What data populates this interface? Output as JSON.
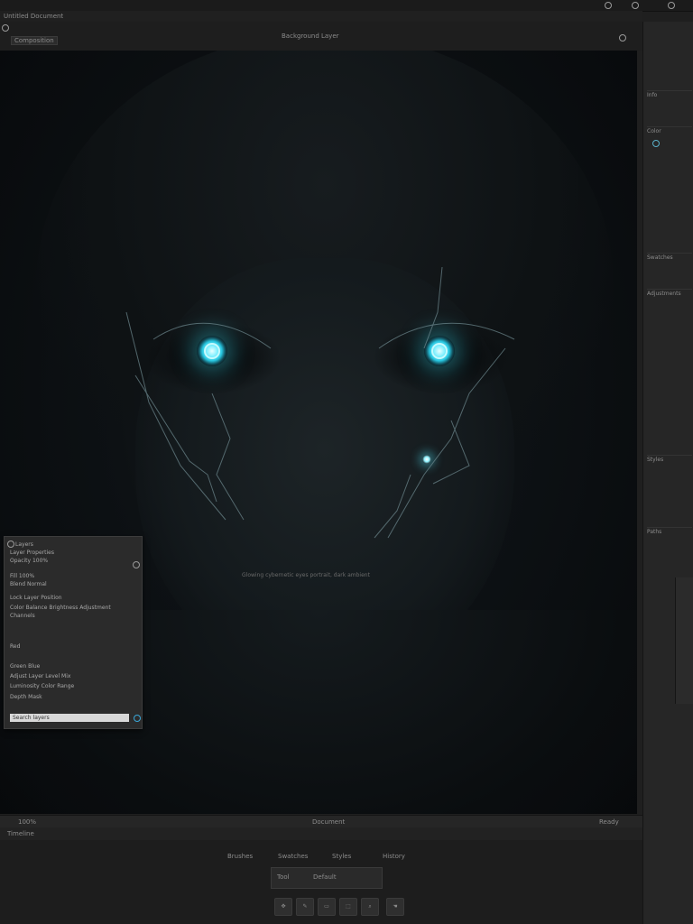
{
  "app": {
    "title": "Untitled Document",
    "doc_tab": "Composition",
    "doc_info": "Background Layer"
  },
  "floating_panel": {
    "title": "Layers",
    "lines": [
      "Layer Properties",
      "Opacity 100%",
      "Fill 100%",
      "Blend Normal",
      "Lock Layer Position",
      "Color Balance Brightness Adjustment",
      "Channels",
      "Red",
      "Green Blue",
      "Adjust Layer Level Mix",
      "Luminosity Color Range",
      "Depth Mask"
    ],
    "input_value": "Search layers"
  },
  "canvas": {
    "overlay_text": "Glowing cybernetic eyes portrait, dark ambient"
  },
  "status_bar": {
    "left": "100%",
    "center": "Document",
    "right": "Ready"
  },
  "timeline": {
    "label": "Timeline"
  },
  "bottom": {
    "tabs": [
      "Brushes",
      "Swatches",
      "Styles",
      "History"
    ],
    "panel_title": "Tool",
    "panel_value": "Default"
  },
  "right_panel": {
    "sections": [
      "Info",
      "Color",
      "Swatches",
      "Adjustments",
      "Styles",
      "Paths"
    ]
  },
  "colors": {
    "glow": "#27c6e0",
    "panel_bg": "#2b2b2b",
    "canvas_bg": "#0d1114"
  }
}
